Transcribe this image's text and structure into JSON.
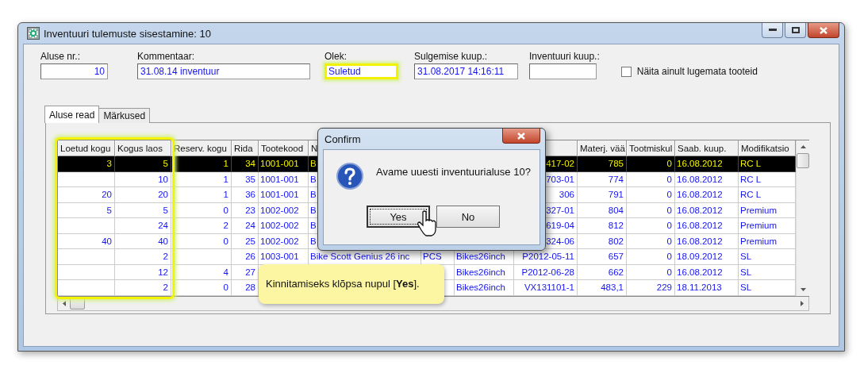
{
  "window": {
    "title": "Inventuuri tulemuste sisestamine: 10"
  },
  "fields": [
    {
      "label": "Aluse nr.:",
      "value": "10",
      "kind": "number",
      "highlighted": false
    },
    {
      "label": "Kommentaar:",
      "value": "31.08.14 inventuur",
      "kind": "text",
      "highlighted": false
    },
    {
      "label": "Olek:",
      "value": "Suletud",
      "kind": "text",
      "highlighted": true
    },
    {
      "label": "Sulgemise kuup.:",
      "value": "31.08.2017 14:16:11",
      "kind": "text",
      "highlighted": false
    },
    {
      "label": "Inventuuri kuup.:",
      "kind": "text",
      "highlighted": false
    }
  ],
  "checkbox": {
    "label": "Näita ainult lugemata tooteid",
    "checked": false
  },
  "tabs": [
    {
      "label": "Aluse read",
      "selected": true
    },
    {
      "label": "Märkused",
      "selected": false
    }
  ],
  "table": {
    "highlighted": true,
    "columns": [
      "Loetud kogu",
      "Kogus laos",
      "Reserv. kogu",
      "Rida",
      "Tootekood",
      "N",
      null,
      null,
      null,
      "Materj. vää",
      "Tootmiskul",
      "Saab. kuup.",
      "Modifikatsio"
    ],
    "rows": [
      {
        "selected": true,
        "cells": [
          "3",
          "5",
          "1",
          "34",
          "1001-001",
          "B",
          null,
          null,
          "417-02",
          "785",
          "0",
          "16.08.2012",
          "RC L"
        ]
      },
      {
        "selected": false,
        "cells": [
          null,
          "10",
          "1",
          "35",
          "1001-001",
          "B",
          null,
          null,
          "703-01",
          "774",
          "0",
          "16.08.2012",
          "RC L"
        ]
      },
      {
        "selected": false,
        "cells": [
          "20",
          "20",
          "1",
          "36",
          "1001-001",
          "B",
          null,
          null,
          "306",
          "791",
          "0",
          "16.08.2012",
          "RC L"
        ]
      },
      {
        "selected": false,
        "cells": [
          "5",
          "5",
          "0",
          "23",
          "1002-002",
          "B",
          null,
          null,
          "327-01",
          "804",
          "0",
          "16.08.2012",
          "Premium"
        ]
      },
      {
        "selected": false,
        "cells": [
          null,
          "24",
          "2",
          "24",
          "1002-002",
          "B",
          null,
          null,
          "619-04",
          "812",
          "0",
          "16.08.2012",
          "Premium"
        ]
      },
      {
        "selected": false,
        "cells": [
          "40",
          "40",
          "0",
          "25",
          "1002-002",
          "B",
          null,
          null,
          "324-06",
          "802",
          "0",
          "16.08.2012",
          "Premium"
        ]
      },
      {
        "selected": false,
        "cells": [
          null,
          "2",
          null,
          "26",
          "1003-001",
          "Bike Scott Genius 26 inc",
          "PCS",
          "Bikes26inch",
          "P2012-05-11",
          "657",
          "0",
          "18.09.2012",
          "SL"
        ]
      },
      {
        "selected": false,
        "cells": [
          null,
          "12",
          "4",
          "27",
          null,
          null,
          null,
          "Bikes26inch",
          "P2012-06-28",
          "662",
          "0",
          "16.08.2012",
          "SL"
        ]
      },
      {
        "selected": false,
        "cells": [
          null,
          "2",
          "0",
          "28",
          null,
          null,
          null,
          "Bikes26inch",
          "VX131101-1",
          "483,1",
          "229",
          "18.11.2013",
          "SL"
        ]
      }
    ]
  },
  "dialog": {
    "title": "Confirm",
    "message": "Avame uuesti inventuurialuse 10?",
    "buttons": [
      {
        "label": "Yes",
        "focused": true
      },
      {
        "label": "No",
        "focused": false
      }
    ]
  },
  "callout": {
    "text": "Kinnitamiseks klõpsa nupul [**Yes**]."
  }
}
